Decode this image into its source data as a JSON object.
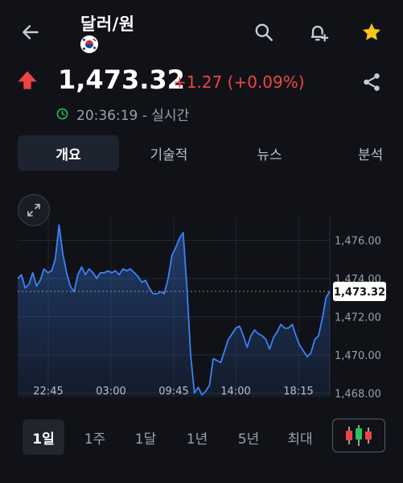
{
  "header": {
    "title": "달러/원",
    "back_icon": "arrow-left-icon",
    "search_icon": "search-icon",
    "alert_icon": "bell-plus-icon",
    "favorite_icon": "star-icon",
    "flag_icon": "south-korea-flag-icon"
  },
  "quote": {
    "price": "1,473.32",
    "change": "+1.27 (+0.09%)",
    "time": "20:36:19 - 실시간",
    "direction_icon": "arrow-up-icon",
    "share_icon": "share-icon",
    "clock_icon": "clock-icon"
  },
  "tabs": [
    "개요",
    "기술적",
    "뉴스",
    "분석"
  ],
  "chart_data": {
    "type": "area",
    "x_ticks": [
      "22:45",
      "03:00",
      "09:45",
      "14:00",
      "18:15"
    ],
    "y_ticks": [
      "1,476.00",
      "1,474.00",
      "1,472.00",
      "1,470.00",
      "1,468.00"
    ],
    "ylim": [
      1467.8,
      1477.2
    ],
    "current_label": "1,473.32",
    "current_value": 1473.32,
    "values": [
      1474.0,
      1474.2,
      1473.5,
      1473.7,
      1474.3,
      1473.6,
      1473.9,
      1474.5,
      1474.3,
      1474.4,
      1475.0,
      1476.8,
      1475.3,
      1474.3,
      1473.6,
      1473.3,
      1474.2,
      1474.6,
      1474.2,
      1474.5,
      1474.3,
      1474.0,
      1474.3,
      1474.3,
      1474.4,
      1474.3,
      1474.4,
      1474.2,
      1474.5,
      1474.4,
      1474.5,
      1474.3,
      1474.1,
      1473.8,
      1473.9,
      1473.5,
      1473.2,
      1473.2,
      1473.3,
      1473.2,
      1474.0,
      1475.2,
      1475.6,
      1476.1,
      1476.4,
      1473.5,
      1470.0,
      1468.0,
      1468.3,
      1467.9,
      1468.1,
      1468.4,
      1469.8,
      1469.7,
      1469.6,
      1470.2,
      1470.8,
      1471.1,
      1471.4,
      1471.5,
      1471.0,
      1470.4,
      1471.0,
      1471.3,
      1471.1,
      1471.0,
      1470.8,
      1470.3,
      1470.9,
      1471.2,
      1471.6,
      1471.4,
      1471.4,
      1471.6,
      1471.0,
      1470.5,
      1470.2,
      1469.9,
      1470.1,
      1470.8,
      1471.0,
      1471.9,
      1473.0,
      1473.32
    ]
  },
  "expand_icon": "expand-icon",
  "periods": [
    "1일",
    "1주",
    "1달",
    "1년",
    "5년",
    "최대"
  ],
  "candlestick_icon": "candlestick-chart-icon",
  "colors": {
    "background": "#101218",
    "line": "#3b82f6",
    "up": "#ef4444",
    "time_icon": "#22c55e",
    "star": "#f5c518"
  }
}
